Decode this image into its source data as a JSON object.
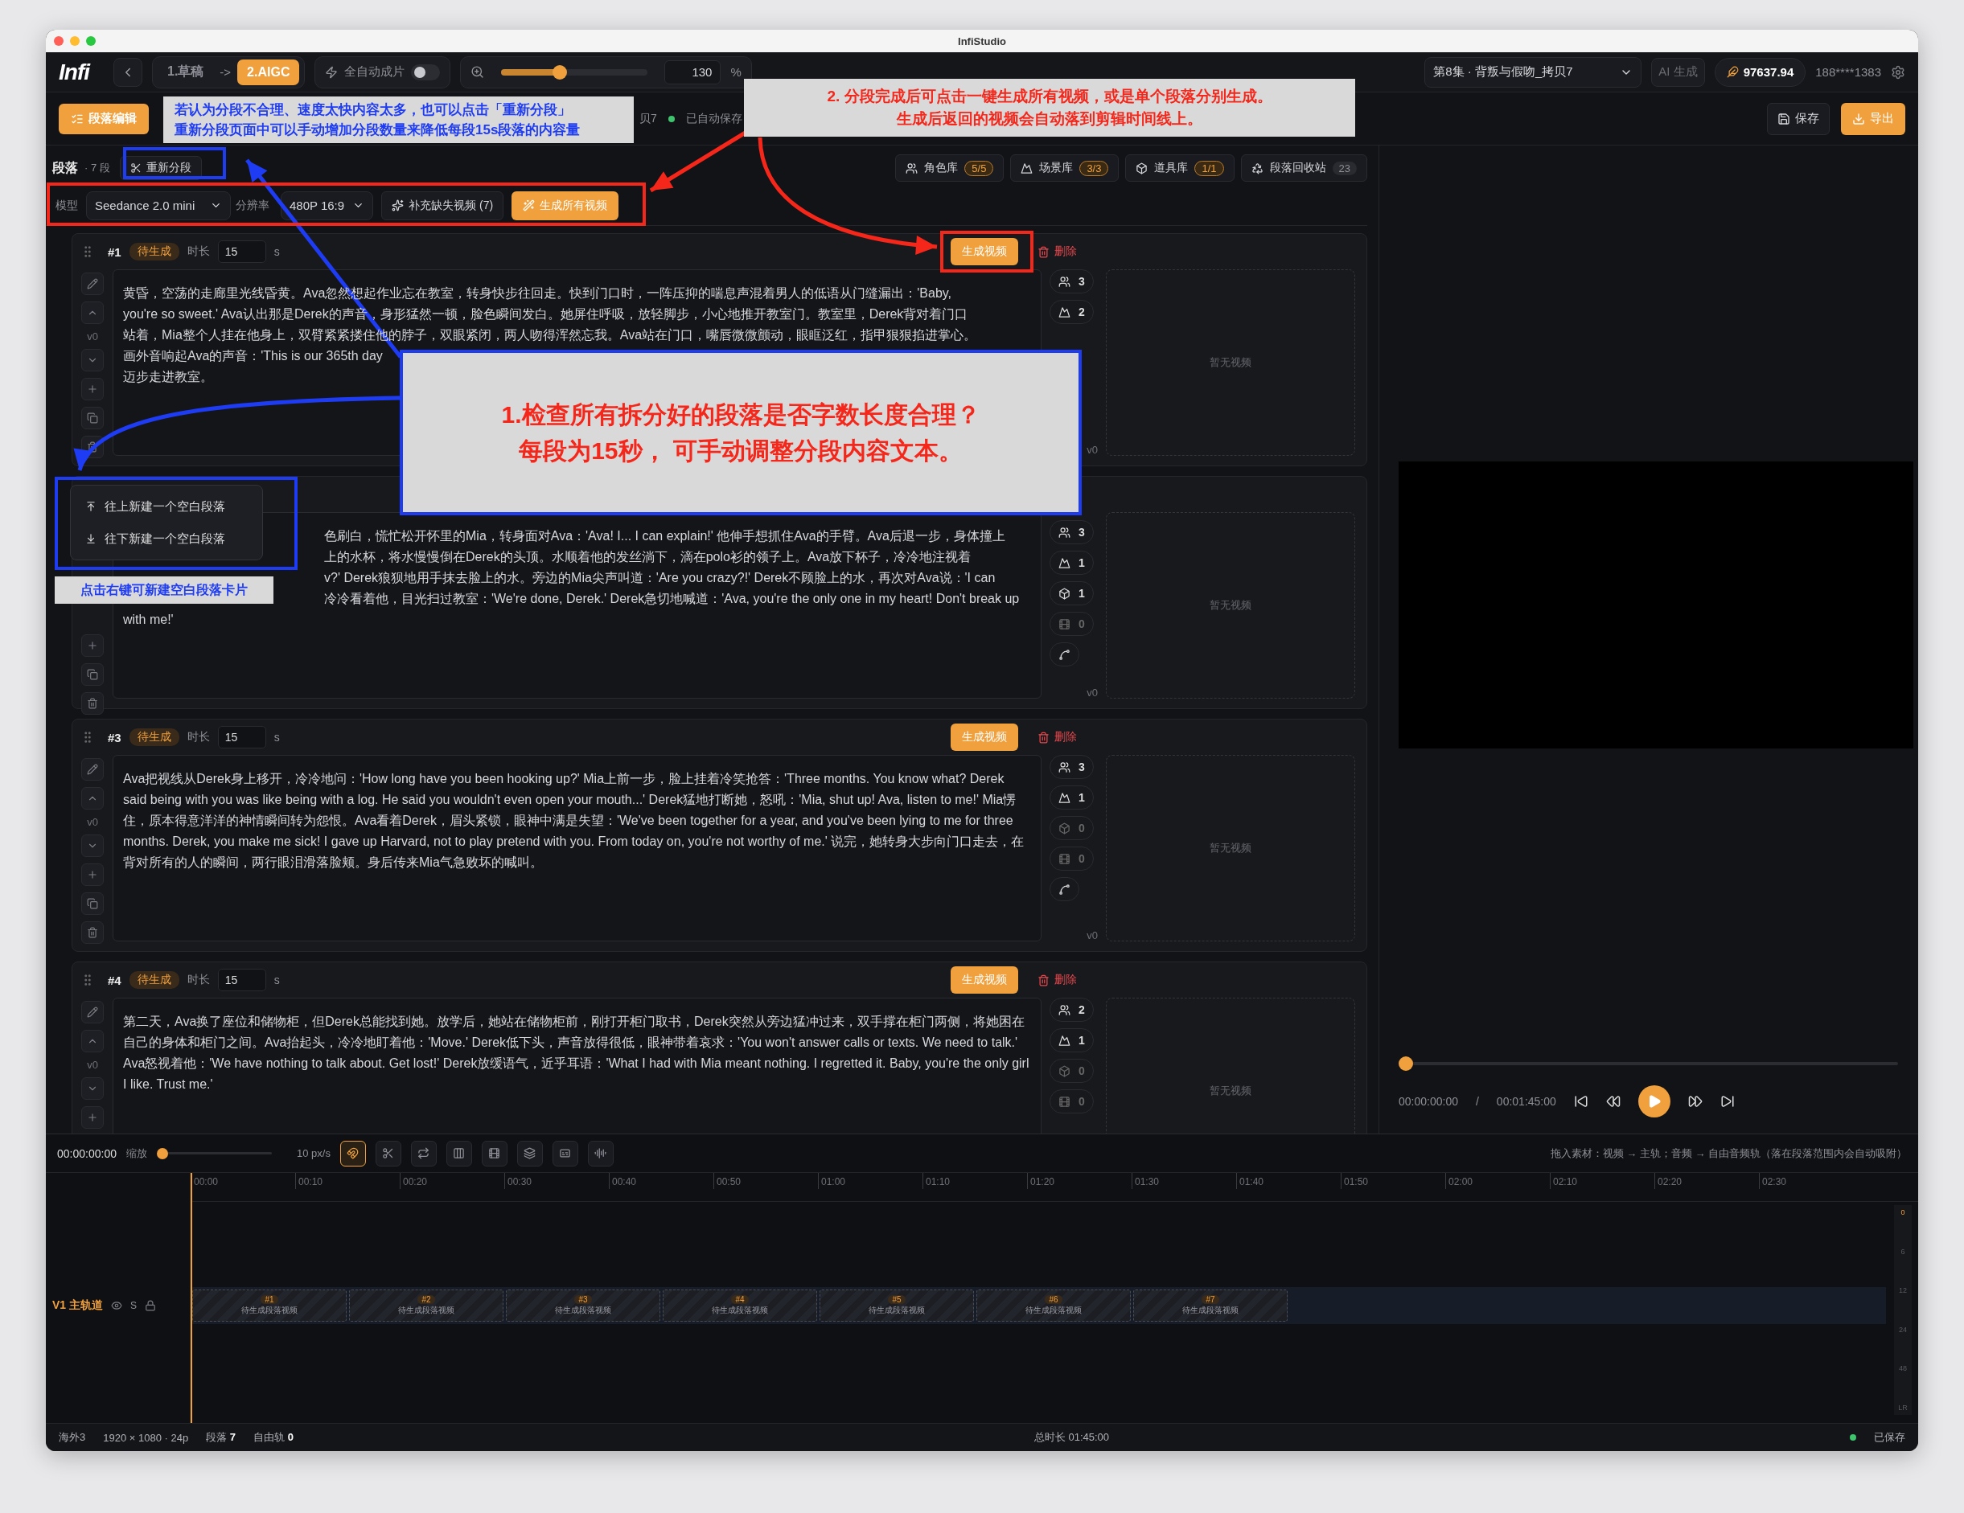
{
  "window": {
    "title": "InfiStudio"
  },
  "topbar": {
    "logo": "Infi",
    "steps": [
      {
        "label": "1.草稿",
        "selected": false
      },
      {
        "label": "2.AIGC",
        "selected": true
      }
    ],
    "step_separator": "->",
    "auto": {
      "label": "全自动成片",
      "on": false
    },
    "zoom": {
      "level": 0.4,
      "value": "130",
      "unit": "%"
    },
    "episode": "第8集 · 背叛与假吻_拷贝7",
    "ai_button": {
      "label": "AI 生成",
      "disabled": true
    },
    "credits": "97637.94",
    "user": "188****1383"
  },
  "actionbar": {
    "mode_button": "段落编辑",
    "fragment": "贝7",
    "autosave": "已自动保存",
    "save": "保存",
    "export": "导出"
  },
  "section": {
    "title": "段落",
    "count": "· 7 段",
    "resplit": "重新分段",
    "libraries": [
      {
        "label": "角色库",
        "badge": "5/5",
        "highlight": true
      },
      {
        "label": "场景库",
        "badge": "3/3",
        "highlight": true
      },
      {
        "label": "道具库",
        "badge": "1/1",
        "highlight": true
      },
      {
        "label": "段落回收站",
        "badge": "23",
        "highlight": false
      }
    ]
  },
  "config": {
    "model_label": "模型",
    "model": "Seedance 2.0 mini",
    "resolution_label": "分辨率",
    "resolution": "480P 16:9",
    "fill_missing": "补充缺失视频 (7)",
    "generate_all": "生成所有视频"
  },
  "segments": [
    {
      "number": "#1",
      "status": "待生成",
      "duration_label": "时长",
      "duration": "15",
      "unit": "s",
      "generate": "生成视频",
      "delete": "删除",
      "version": "v0",
      "lines": [
        {
          "text": "黄昏，空荡的走廊里光线昏黄。Ava忽然想起作业忘在教室，转身快步往回走。快到门口时，一阵压抑的喘息声混着男人的低语从门缝漏出：'Baby,",
          "start_hidden": false
        },
        {
          "text": "you're so sweet.' Ava认出那是Derek的声音，身形猛然一顿，脸色瞬间发白。她屏住呼吸，放轻脚步，小心地推开教室门。教室里，Derek背对着门口",
          "start_hidden": false
        },
        {
          "text": "站着，Mia整个人挂在他身上，双臂紧紧搂住他的脖子，双眼紧闭，两人吻得浑然忘我。Ava站在门口，嘴唇微微颤动，眼眶泛红，指甲狠狠掐进掌心。",
          "start_hidden": false
        },
        {
          "text": "画外音响起Ava的声音：'This is our 365th day",
          "start_hidden": false
        },
        {
          "text": "迈步走进教室。",
          "start_hidden": false
        }
      ],
      "counts": [
        {
          "value": "3",
          "dim": false
        },
        {
          "value": "2",
          "dim": false
        }
      ],
      "link": false,
      "side_version": "v0",
      "preview": "暂无视频"
    },
    {
      "lines": [
        {
          "text": "色刷白，慌忙松开怀里的Mia，转身面对Ava：'Ava! I... I can explain!' 他伸手想抓住Ava的手臂。Ava后退一步，身体撞上",
          "start_hidden": true
        },
        {
          "text": "上的水杯，将水慢慢倒在Derek的头顶。水顺着他的发丝淌下，滴在polo衫的领子上。Ava放下杯子，冷冷地注视着",
          "start_hidden": true
        },
        {
          "text": "v?' Derek狼狈地用手抹去脸上的水。旁边的Mia尖声叫道：'Are you crazy?!' Derek不顾脸上的水，再次对Ava说：'I can",
          "start_hidden": true
        },
        {
          "text": "冷冷看着他，目光扫过教室：'We're done, Derek.' Derek急切地喊道：'Ava, you're the only one in my heart! Don't break up",
          "start_hidden": true
        },
        {
          "text": "with me!'",
          "start_hidden": false
        }
      ],
      "counts": [
        {
          "value": "3",
          "dim": false
        },
        {
          "value": "1",
          "dim": false
        },
        {
          "value": "1",
          "dim": false
        },
        {
          "value": "0",
          "dim": true
        }
      ],
      "link": true,
      "side_version": "v0",
      "preview": "暂无视频"
    },
    {
      "number": "#3",
      "status": "待生成",
      "duration_label": "时长",
      "duration": "15",
      "unit": "s",
      "generate": "生成视频",
      "delete": "删除",
      "version": "v0",
      "lines": [
        {
          "text": "Ava把视线从Derek身上移开，冷冷地问：'How long have you been hooking up?' Mia上前一步，脸上挂着冷笑抢答：'Three months. You know what? Derek said being with you was like being with a log. He said you wouldn't even open your mouth...' Derek猛地打断她，怒吼：'Mia, shut up! Ava, listen to me!' Mia愣住，原本得意洋洋的神情瞬间转为怨恨。Ava看着Derek，眉头紧锁，眼神中满是失望：'We've been together for a year, and you've been lying to me for three months. Derek, you make me sick! I gave up Harvard, not to play pretend with you. From today on, you're not worthy of me.' 说完，她转身大步向门口走去，在背对所有的人的瞬间，两行眼泪滑落脸颊。身后传来Mia气急败坏的喊叫。",
          "start_hidden": false
        }
      ],
      "counts": [
        {
          "value": "3",
          "dim": false
        },
        {
          "value": "1",
          "dim": false
        },
        {
          "value": "0",
          "dim": true
        },
        {
          "value": "0",
          "dim": true
        }
      ],
      "link": true,
      "side_version": "v0",
      "preview": "暂无视频"
    },
    {
      "number": "#4",
      "status": "待生成",
      "duration_label": "时长",
      "duration": "15",
      "unit": "s",
      "generate": "生成视频",
      "delete": "删除",
      "version": "v0",
      "lines": [
        {
          "text": "第二天，Ava换了座位和储物柜，但Derek总能找到她。放学后，她站在储物柜前，刚打开柜门取书，Derek突然从旁边猛冲过来，双手撑在柜门两侧，将她困在自己的身体和柜门之间。Ava抬起头，冷冷地盯着他：'Move.' Derek低下头，声音放得很低，眼神带着哀求：'You won't answer calls or texts. We need to talk.' Ava怒视着他：'We have nothing to talk about. Get lost!' Derek放缓语气，近乎耳语：'What I had with Mia meant nothing. I regretted it. Baby, you're the only girl I like. Trust me.'",
          "start_hidden": false
        }
      ],
      "counts": [
        {
          "value": "2",
          "dim": false
        },
        {
          "value": "1",
          "dim": false
        },
        {
          "value": "0",
          "dim": true
        },
        {
          "value": "0",
          "dim": true
        }
      ],
      "link": false,
      "preview": "暂无视频",
      "truncated": true
    }
  ],
  "context_menu": {
    "items": [
      "往上新建一个空白段落",
      "往下新建一个空白段落"
    ]
  },
  "annotations": [
    {
      "kind": "note",
      "color": "#1f3cf5",
      "lines": [
        "若认为分段不合理、速度太快内容太多，也可以点击「重新分段」",
        "重新分段页面中可以手动增加分段数量来降低每段15s段落的内容量"
      ]
    },
    {
      "kind": "note",
      "color": "#f5261a",
      "lines": [
        "2. 分段完成后可点击一键生成所有视频，或是单个段落分别生成。",
        "生成后返回的视频会自动落到剪辑时间线上。"
      ]
    },
    {
      "kind": "callout",
      "color": "#f5261a",
      "lines": [
        "1.检查所有拆分好的段落是否字数长度合理？",
        "每段为15秒， 可手动调整分段内容文本。"
      ]
    },
    {
      "kind": "label",
      "color": "#1f3cf5",
      "lines": [
        "点击右键可新建空白段落卡片"
      ]
    }
  ],
  "player": {
    "level": 0,
    "time": "00:00:00:00",
    "separator": "/",
    "total": "00:01:45:00"
  },
  "timeline": {
    "time": "00:00:00:00",
    "zoom_label": "缩放",
    "zoom_slider": {
      "level": 0
    },
    "zoom_value": "10 px/s",
    "tools": [
      {
        "active": true
      },
      {
        "active": false
      },
      {
        "active": false
      },
      {
        "active": false
      },
      {
        "active": false
      },
      {
        "active": false
      },
      {
        "active": false
      },
      {
        "active": false
      }
    ],
    "hint": "拖入素材：视频 → 主轨；音频 → 自由音频轨（落在段落范围内会自动吸附）",
    "ticks": [
      "00:00",
      "00:10",
      "00:20",
      "00:30",
      "00:40",
      "00:50",
      "01:00",
      "01:10",
      "01:20",
      "01:30",
      "01:40",
      "01:50",
      "02:00",
      "02:10",
      "02:20",
      "02:30"
    ],
    "track": {
      "label": "V1 主轨道",
      "solo": "S",
      "clips": [
        {
          "label": "#1",
          "caption": "待生成段落视频"
        },
        {
          "label": "#2",
          "caption": "待生成段落视频"
        },
        {
          "label": "#3",
          "caption": "待生成段落视频"
        },
        {
          "label": "#4",
          "caption": "待生成段落视频"
        },
        {
          "label": "#5",
          "caption": "待生成段落视频"
        },
        {
          "label": "#6",
          "caption": "待生成段落视频"
        },
        {
          "label": "#7",
          "caption": "待生成段落视频"
        }
      ]
    },
    "meter": [
      "0",
      "6",
      "12",
      "24",
      "48",
      "LR"
    ]
  },
  "status_bar": {
    "project": "海外3",
    "format": "1920 × 1080 · 24p",
    "segments_label": "段落",
    "segments": "7",
    "free_label": "自由轨",
    "free": "0",
    "total": "总时长 01:45:00",
    "saved": "已保存"
  }
}
